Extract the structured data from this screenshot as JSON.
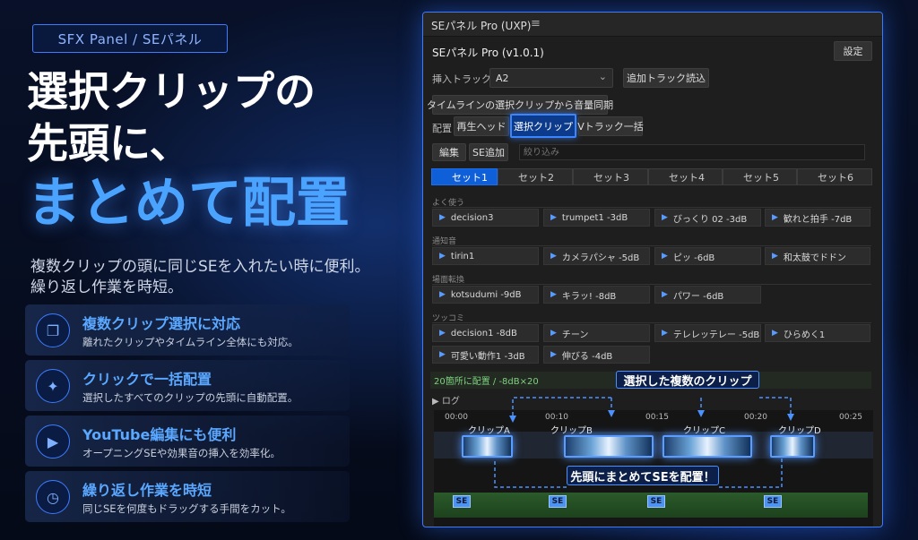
{
  "promo": {
    "pill": "SFX Panel / SEパネル",
    "headline": [
      "選択クリップの",
      "先頭に、",
      "まとめて配置"
    ],
    "subtitle": [
      "複数クリップの頭に同じSEを入れたい時に便利。",
      "繰り返し作業を時短。"
    ],
    "features": [
      {
        "icon": "multi-select-icon",
        "glyph": "❐",
        "title": "複数クリップ選択に対応",
        "desc": "離れたクリップやタイムライン全体にも対応。"
      },
      {
        "icon": "click-cursor-icon",
        "glyph": "✦",
        "title": "クリックで一括配置",
        "desc": "選択したすべてのクリップの先頭に自動配置。"
      },
      {
        "icon": "youtube-icon",
        "glyph": "▶",
        "title": "YouTube編集にも便利",
        "desc": "オープニングSEや効果音の挿入を効率化。"
      },
      {
        "icon": "stopwatch-icon",
        "glyph": "◷",
        "title": "繰り返し作業を時短",
        "desc": "同じSEを何度もドラッグする手間をカット。"
      }
    ]
  },
  "panel": {
    "window_title": "SEパネル Pro (UXP)",
    "menu_glyph": "≡",
    "app_title": "SEパネル Pro (v1.0.1)",
    "settings_label": "設定",
    "insert_track_label": "挿入トラック",
    "insert_track_value": "A2",
    "load_tracks_label": "追加トラック読込",
    "sync_volume_label": "タイムラインの選択クリップから音量同期",
    "placement_label": "配置",
    "placement_options": [
      "再生ヘッド",
      "選択クリップ",
      "Vトラック一括"
    ],
    "edit_label": "編集",
    "add_se_label": "SE追加",
    "filter_placeholder": "絞り込み",
    "sets": [
      "セット1",
      "セット2",
      "セット3",
      "セット4",
      "セット5",
      "セット6"
    ],
    "categories": [
      {
        "name": "よく使う",
        "items": [
          "decision3",
          "trumpet1 -3dB",
          "びっくり 02 -3dB",
          "歓れと拍手 -7dB"
        ]
      },
      {
        "name": "通知音",
        "items": [
          "tirin1",
          "カメラパシャ -5dB",
          "ピッ -6dB",
          "和太鼓でドドン"
        ]
      },
      {
        "name": "場面転換",
        "items": [
          "kotsudumi -9dB",
          "キラッ! -8dB",
          "パワー -6dB"
        ]
      },
      {
        "name": "ツッコミ",
        "items": [
          "decision1 -8dB",
          "チーン",
          "テレレッテレー -5dB",
          "ひらめく1",
          "可愛い動作1 -3dB",
          "伸びる -4dB"
        ]
      }
    ],
    "status": "20箇所に配置 / -8dB×20",
    "log_label": "▶ ログ",
    "timeline": {
      "ticks": [
        "00:00",
        "00:10",
        "00:15",
        "00:20",
        "00:25"
      ],
      "clips": [
        "クリップA",
        "クリップB",
        "クリップC",
        "クリップD"
      ],
      "se_badge": "SE"
    },
    "callouts": {
      "top": "選択した複数のクリップ",
      "bottom": "先頭にまとめてSEを配置！"
    }
  },
  "colors": {
    "accent": "#3b86ff",
    "headline_blue": "#4aa3ff",
    "status_green": "#7fd17f"
  }
}
